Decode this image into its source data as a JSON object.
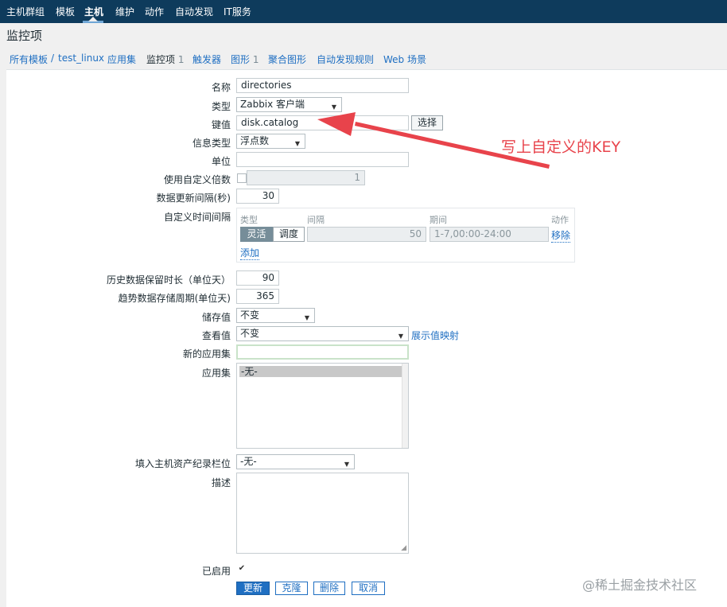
{
  "topnav": {
    "items": [
      "主机群组",
      "模板",
      "主机",
      "维护",
      "动作",
      "自动发现",
      "IT服务"
    ],
    "active_index": 2
  },
  "page": {
    "title": "监控项"
  },
  "breadcrumbs": {
    "all_templates": "所有模板",
    "separator": "/",
    "host": "test_linux",
    "tabs": [
      {
        "label": "应用集",
        "count": ""
      },
      {
        "label": "监控项",
        "count": "1"
      },
      {
        "label": "触发器",
        "count": ""
      },
      {
        "label": "图形",
        "count": "1"
      },
      {
        "label": "聚合图形",
        "count": ""
      },
      {
        "label": "自动发现规则",
        "count": ""
      },
      {
        "label": "Web 场景",
        "count": ""
      }
    ],
    "current_tab": "监控项"
  },
  "form": {
    "name": {
      "label": "名称",
      "value": "directories"
    },
    "type": {
      "label": "类型",
      "value": "Zabbix 客户端"
    },
    "key": {
      "label": "键值",
      "value": "disk.catalog",
      "select_button": "选择"
    },
    "value_type": {
      "label": "信息类型",
      "value": "浮点数"
    },
    "units": {
      "label": "单位",
      "value": ""
    },
    "multiplier": {
      "label": "使用自定义倍数",
      "checked": false,
      "value": "1"
    },
    "delay": {
      "label": "数据更新间隔(秒)",
      "value": "30"
    },
    "custom_intervals": {
      "label": "自定义时间间隔",
      "headers": {
        "type": "类型",
        "interval": "间隔",
        "period": "期间",
        "action": "动作"
      },
      "mode_flexible": "灵活",
      "mode_scheduling": "调度",
      "interval_value": "50",
      "period_value": "1-7,00:00-24:00",
      "remove_link": "移除",
      "add_link": "添加"
    },
    "history": {
      "label": "历史数据保留时长（单位天）",
      "value": "90"
    },
    "trends": {
      "label": "趋势数据存储周期(单位天)",
      "value": "365"
    },
    "store_value": {
      "label": "储存值",
      "value": "不变"
    },
    "show_value": {
      "label": "查看值",
      "value": "不变",
      "mapping_link": "展示值映射"
    },
    "new_application": {
      "label": "新的应用集",
      "value": ""
    },
    "applications": {
      "label": "应用集",
      "options": [
        "-无-"
      ]
    },
    "inventory": {
      "label": "填入主机资产纪录栏位",
      "value": "-无-"
    },
    "description": {
      "label": "描述",
      "value": ""
    },
    "enabled": {
      "label": "已启用",
      "checked": true
    }
  },
  "buttons": {
    "update": "更新",
    "clone": "克隆",
    "delete": "删除",
    "cancel": "取消"
  },
  "annotation": {
    "text": "写上自定义的KEY"
  },
  "watermark": {
    "text": "@稀土掘金技术社区"
  },
  "colors": {
    "topnav_bg": "#0e3b5c",
    "link": "#1f6fc2",
    "annotation": "#e8434b",
    "primary_button": "#1f6fc2"
  }
}
